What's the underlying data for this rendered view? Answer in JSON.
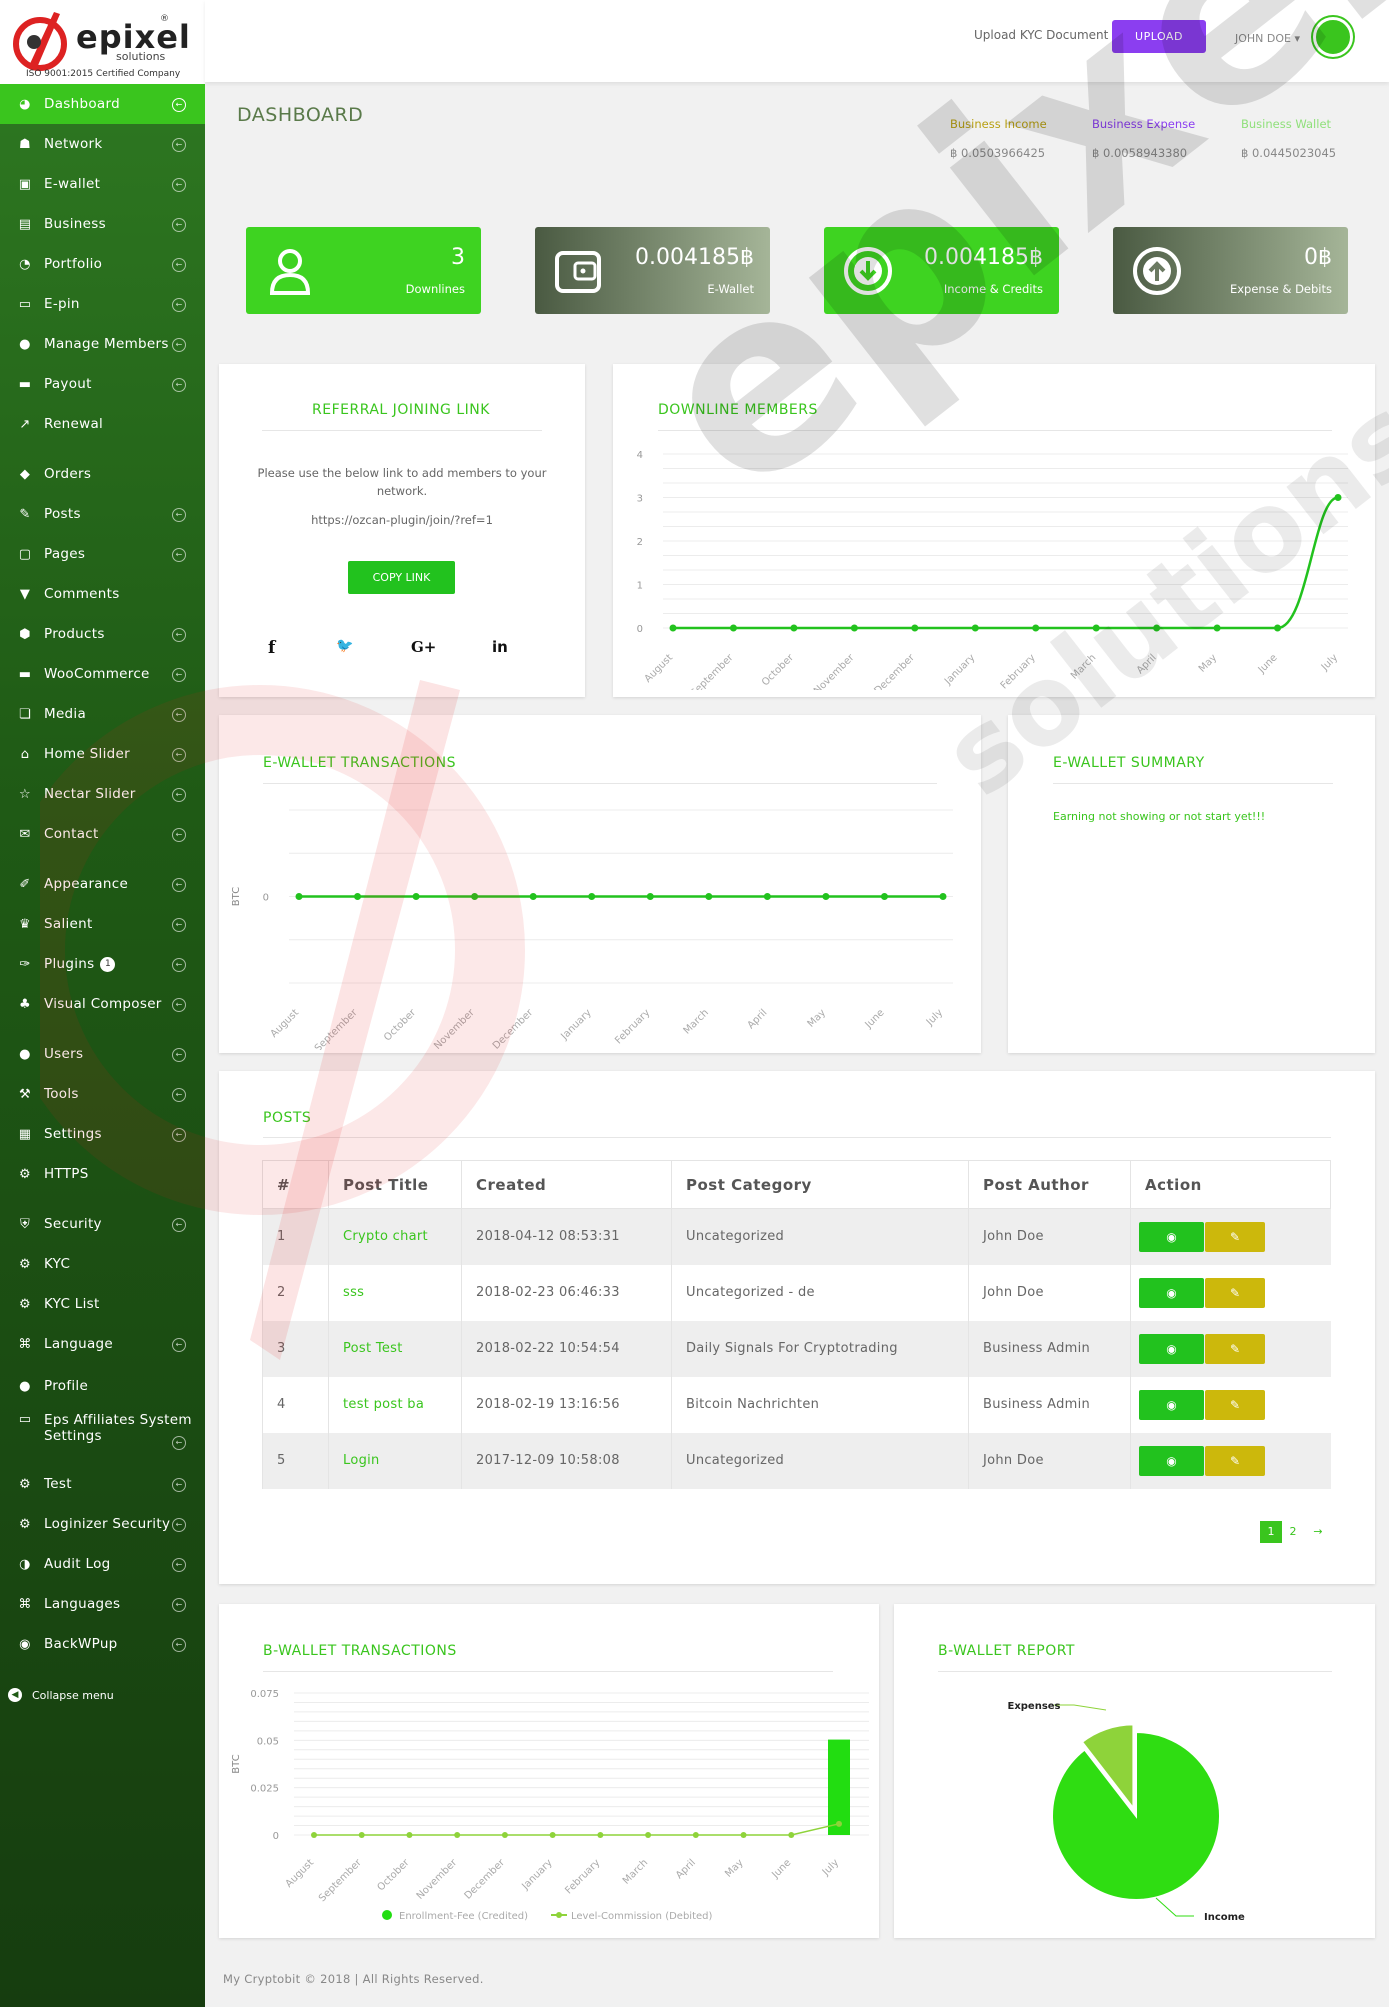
{
  "brand": {
    "name": "epixel",
    "sub": "solutions",
    "iso": "ISO 9001:2015 Certified Company",
    "mark": "®"
  },
  "sidebar": {
    "items": [
      {
        "label": "Dashboard",
        "icon": "dashboard-icon",
        "glyph": "◕",
        "chev": true,
        "active": true
      },
      {
        "label": "Network",
        "icon": "network-icon",
        "glyph": "☗",
        "chev": true
      },
      {
        "label": "E-wallet",
        "icon": "wallet-icon",
        "glyph": "▣",
        "chev": true
      },
      {
        "label": "Business",
        "icon": "business-icon",
        "glyph": "▤",
        "chev": true
      },
      {
        "label": "Portfolio",
        "icon": "portfolio-icon",
        "glyph": "◔",
        "chev": true
      },
      {
        "label": "E-pin",
        "icon": "epin-icon",
        "glyph": "▭",
        "chev": true
      },
      {
        "label": "Manage Members",
        "icon": "members-icon",
        "glyph": "●",
        "chev": true
      },
      {
        "label": "Payout",
        "icon": "payout-icon",
        "glyph": "▬",
        "chev": true
      },
      {
        "label": "Renewal",
        "icon": "renewal-icon",
        "glyph": "↗",
        "chev": false
      },
      {
        "label": "Orders",
        "icon": "orders-icon",
        "glyph": "◆",
        "chev": false
      },
      {
        "label": "Posts",
        "icon": "pin-icon",
        "glyph": "✎",
        "chev": true
      },
      {
        "label": "Pages",
        "icon": "pages-icon",
        "glyph": "▢",
        "chev": true
      },
      {
        "label": "Comments",
        "icon": "comments-icon",
        "glyph": "▼",
        "chev": false
      },
      {
        "label": "Products",
        "icon": "products-icon",
        "glyph": "⬢",
        "chev": true
      },
      {
        "label": "WooCommerce",
        "icon": "woocommerce-icon",
        "glyph": "▬",
        "chev": true
      },
      {
        "label": "Media",
        "icon": "media-icon",
        "glyph": "❏",
        "chev": true
      },
      {
        "label": "Home Slider",
        "icon": "home-icon",
        "glyph": "⌂",
        "chev": true
      },
      {
        "label": "Nectar Slider",
        "icon": "star-icon",
        "glyph": "☆",
        "chev": true
      },
      {
        "label": "Contact",
        "icon": "mail-icon",
        "glyph": "✉",
        "chev": true
      },
      {
        "label": "Appearance",
        "icon": "brush-icon",
        "glyph": "✐",
        "chev": true
      },
      {
        "label": "Salient",
        "icon": "crown-icon",
        "glyph": "♛",
        "chev": true
      },
      {
        "label": "Plugins",
        "icon": "plugin-icon",
        "glyph": "✑",
        "chev": true,
        "badge": "1"
      },
      {
        "label": "Visual Composer",
        "icon": "composer-icon",
        "glyph": "♣",
        "chev": true
      },
      {
        "label": "Users",
        "icon": "user-icon",
        "glyph": "●",
        "chev": true
      },
      {
        "label": "Tools",
        "icon": "wrench-icon",
        "glyph": "⚒",
        "chev": true
      },
      {
        "label": "Settings",
        "icon": "settings-icon",
        "glyph": "▦",
        "chev": true
      },
      {
        "label": "HTTPS",
        "icon": "gear-icon",
        "glyph": "⚙",
        "chev": false
      },
      {
        "label": "Security",
        "icon": "shield-icon",
        "glyph": "⛨",
        "chev": true
      },
      {
        "label": "KYC",
        "icon": "gear-icon",
        "glyph": "⚙",
        "chev": false
      },
      {
        "label": "KYC List",
        "icon": "gear-icon",
        "glyph": "⚙",
        "chev": false
      },
      {
        "label": "Language",
        "icon": "language-icon",
        "glyph": "⌘",
        "chev": true
      },
      {
        "label": "Profile",
        "icon": "profile-icon",
        "glyph": "●",
        "chev": false
      },
      {
        "label": "Eps Affiliates System Settings",
        "icon": "monitor-icon",
        "glyph": "▭",
        "chev": true
      },
      {
        "label": "Test",
        "icon": "gear-icon",
        "glyph": "⚙",
        "chev": true
      },
      {
        "label": "Loginizer Security",
        "icon": "gear-icon",
        "glyph": "⚙",
        "chev": true
      },
      {
        "label": "Audit Log",
        "icon": "audit-icon",
        "glyph": "◑",
        "chev": true
      },
      {
        "label": "Languages",
        "icon": "languages-icon",
        "glyph": "⌘",
        "chev": true
      },
      {
        "label": "BackWPup",
        "icon": "backup-icon",
        "glyph": "◉",
        "chev": true
      }
    ],
    "collapse": "Collapse menu"
  },
  "topbar": {
    "kyc_text": "Upload KYC Document",
    "upload_label": "UPLOAD",
    "user": "JOHN DOE ▾"
  },
  "page_title": "DASHBOARD",
  "stats": [
    {
      "label": "Business Income",
      "value": "฿ 0.0503966425",
      "color": "#b8a012"
    },
    {
      "label": "Business Expense",
      "value": "฿ 0.0058943380",
      "color": "#8b3ef0"
    },
    {
      "label": "Business Wallet",
      "value": "฿ 0.0445023045",
      "color": "#8fe07a"
    }
  ],
  "cards": [
    {
      "num": "3",
      "label": "Downlines"
    },
    {
      "num": "0.004185฿",
      "label": "E-Wallet"
    },
    {
      "num": "0.004185฿",
      "label": "Income & Credits"
    },
    {
      "num": "0฿",
      "label": "Expense & Debits"
    }
  ],
  "referral": {
    "title": "REFERRAL JOINING LINK",
    "text": "Please use the below link to add members to your network.",
    "link": "https://ozcan-plugin/join/?ref=1",
    "button": "COPY LINK",
    "social": [
      "f",
      "🐦",
      "G+",
      "in"
    ]
  },
  "downline": {
    "title": "DOWNLINE MEMBERS"
  },
  "ewallet_tx": {
    "title": "E-WALLET TRANSACTIONS"
  },
  "ewallet_summary": {
    "title": "E-WALLET SUMMARY",
    "text": "Earning not showing or not start yet!!!"
  },
  "posts": {
    "title": "POSTS",
    "columns": [
      "#",
      "Post Title",
      "Created",
      "Post Category",
      "Post Author",
      "Action"
    ],
    "rows": [
      {
        "n": "1",
        "title": "Crypto chart",
        "created": "2018-04-12 08:53:31",
        "category": "Uncategorized",
        "author": "John Doe"
      },
      {
        "n": "2",
        "title": "sss",
        "created": "2018-02-23 06:46:33",
        "category": "Uncategorized - de",
        "author": "John Doe"
      },
      {
        "n": "3",
        "title": "Post Test",
        "created": "2018-02-22 10:54:54",
        "category": "Daily Signals For Cryptotrading",
        "author": "Business Admin"
      },
      {
        "n": "4",
        "title": "test post ba",
        "created": "2018-02-19 13:16:56",
        "category": "Bitcoin Nachrichten",
        "author": "Business Admin"
      },
      {
        "n": "5",
        "title": "Login",
        "created": "2017-12-09 10:58:08",
        "category": "Uncategorized",
        "author": "John Doe"
      }
    ],
    "pager": [
      "1",
      "2",
      "→"
    ]
  },
  "bwallet_tx": {
    "title": "B-WALLET TRANSACTIONS"
  },
  "bwallet_report": {
    "title": "B-WALLET REPORT"
  },
  "footer": "My Cryptobit © 2018 | All Rights Reserved.",
  "chart_data": [
    {
      "type": "line",
      "name": "downline-members",
      "categories": [
        "August",
        "September",
        "October",
        "November",
        "December",
        "January",
        "February",
        "March",
        "April",
        "May",
        "June",
        "July"
      ],
      "values": [
        0,
        0,
        0,
        0,
        0,
        0,
        0,
        0,
        0,
        0,
        0,
        3
      ],
      "ylim": [
        0,
        4
      ],
      "yticks": [
        "0",
        "1",
        "2",
        "3",
        "4"
      ],
      "color": "#22c21e"
    },
    {
      "type": "line",
      "name": "ewallet-transactions",
      "categories": [
        "August",
        "September",
        "October",
        "November",
        "December",
        "January",
        "February",
        "March",
        "April",
        "May",
        "June",
        "July"
      ],
      "values": [
        0,
        0,
        0,
        0,
        0,
        0,
        0,
        0,
        0,
        0,
        0,
        0
      ],
      "ylabel": "BTC",
      "yticks": [
        "0"
      ],
      "color": "#22c21e"
    },
    {
      "type": "bar",
      "name": "bwallet-transactions",
      "categories": [
        "August",
        "September",
        "October",
        "November",
        "December",
        "January",
        "February",
        "March",
        "April",
        "May",
        "June",
        "July"
      ],
      "ylabel": "BTC",
      "ylim": [
        0,
        0.075
      ],
      "yticks": [
        "0",
        "0.025",
        "0.05",
        "0.075"
      ],
      "series": [
        {
          "name": "Enrollment-Fee (Credited)",
          "type": "bar",
          "values": [
            0,
            0,
            0,
            0,
            0,
            0,
            0,
            0,
            0,
            0,
            0,
            0.0504
          ],
          "color": "#22dd11"
        },
        {
          "name": "Level-Commission (Debited)",
          "type": "line",
          "values": [
            0,
            0,
            0,
            0,
            0,
            0,
            0,
            0,
            0,
            0,
            0,
            0.0059
          ],
          "color": "#8ed33a"
        }
      ],
      "legend": "bottom"
    },
    {
      "type": "pie",
      "name": "bwallet-report",
      "slices": [
        {
          "label": "Income",
          "value": 0.0504,
          "color": "#2fdd12"
        },
        {
          "label": "Expenses",
          "value": 0.0059,
          "color": "#8ed33a"
        }
      ]
    }
  ]
}
